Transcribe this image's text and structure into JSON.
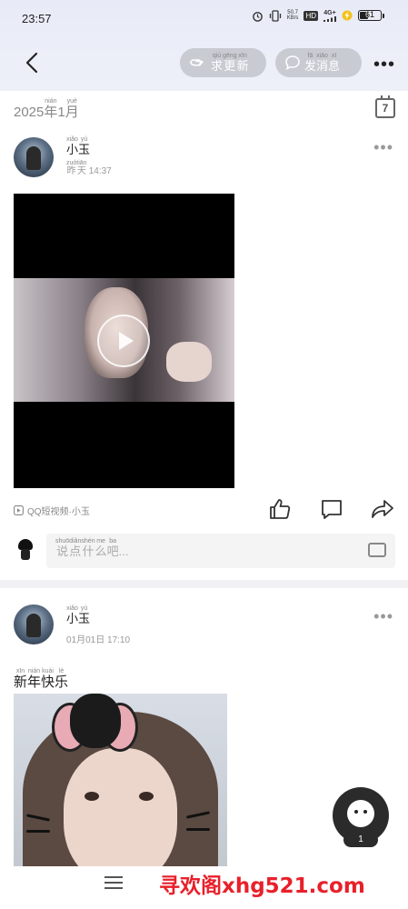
{
  "status_bar": {
    "time": "23:57",
    "net_speed_top": "50.7",
    "net_speed_unit": "KB/s",
    "hd": "HD",
    "signal": "4G+",
    "battery": "61"
  },
  "header": {
    "seek_update_label": "求更新",
    "seek_update_pinyin": [
      "qiú",
      "gēng",
      "xīn"
    ],
    "message_label": "发消息",
    "message_pinyin": [
      "fā",
      "xiāo",
      "xī"
    ],
    "more": "•••"
  },
  "date_header": {
    "year": "2025",
    "year_char": "年",
    "month": "1",
    "month_char": "月",
    "year_pinyin": "nián",
    "month_pinyin": "yuè",
    "calendar_day": "7"
  },
  "posts": [
    {
      "author": "小玉",
      "author_pinyin": [
        "xiǎo",
        "yù"
      ],
      "time_prefix": "昨天",
      "time_prefix_pinyin": [
        "zuó",
        "tiān"
      ],
      "time": "14:37",
      "source": "QQ短视频·小玉",
      "source_pinyin": [
        "duǎn",
        "shì",
        "pín",
        "xiǎo",
        "yù"
      ],
      "comment_placeholder": "说点什么吧...",
      "comment_pinyin": [
        "shuō",
        "diǎn",
        "shén",
        "me",
        "ba"
      ]
    },
    {
      "author": "小玉",
      "author_pinyin": [
        "xiǎo",
        "yù"
      ],
      "time": "01月01日 17:10",
      "caption": "新年快乐",
      "caption_pinyin": [
        "xīn",
        "nián",
        "kuài",
        "lè"
      ]
    }
  ],
  "floating_button": {
    "count": "1"
  },
  "watermark": "寻欢阁xhg521.com",
  "icons": [
    "back-icon",
    "hand-point-icon",
    "chat-bubble-icon",
    "more-icon",
    "calendar-icon",
    "play-icon",
    "video-source-icon",
    "like-icon",
    "comment-icon",
    "share-icon",
    "emoji-keyboard-icon",
    "menu-icon"
  ]
}
